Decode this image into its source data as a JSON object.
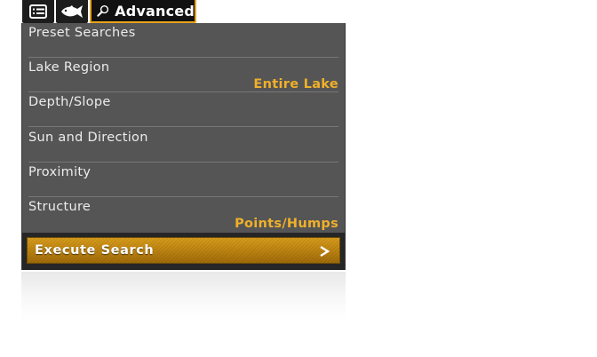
{
  "colors": {
    "panel_bg": "#555555",
    "accent": "#f0b02a",
    "tab_bg": "#1d1d1d",
    "button_gold": "#c08612"
  },
  "tabs": [
    {
      "name": "list",
      "icon": "list-icon",
      "label": ""
    },
    {
      "name": "fish",
      "icon": "fish-icon",
      "label": ""
    },
    {
      "name": "advanced",
      "icon": "magnifier-icon",
      "label": "Advanced",
      "selected": true
    }
  ],
  "menu": {
    "rows": [
      {
        "label": "Preset Searches",
        "value": ""
      },
      {
        "label": "Lake Region",
        "value": "Entire Lake"
      },
      {
        "label": "Depth/Slope",
        "value": ""
      },
      {
        "label": "Sun and Direction",
        "value": ""
      },
      {
        "label": "Proximity",
        "value": ""
      },
      {
        "label": "Structure",
        "value": "Points/Humps"
      }
    ]
  },
  "execute": {
    "label": "Execute Search",
    "icon": "chevron-right-icon"
  }
}
